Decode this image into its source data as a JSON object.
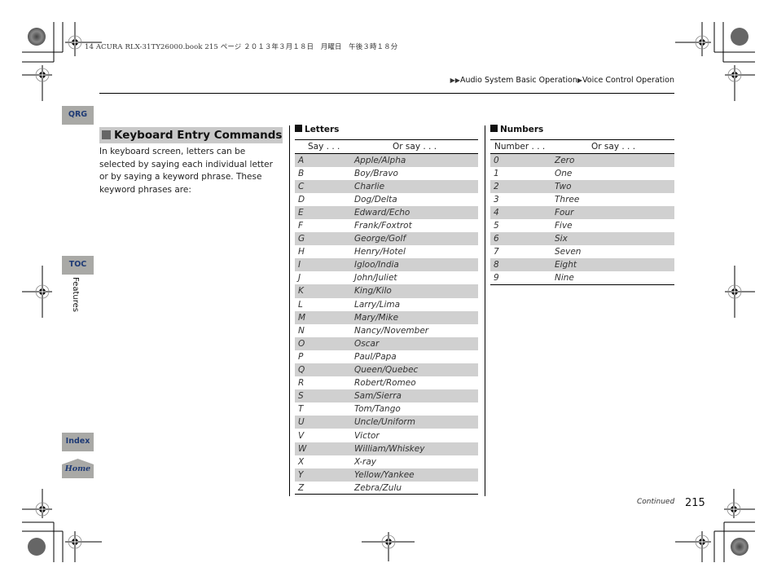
{
  "print_header": "14 ACURA RLX-31TY26000.book  215 ページ  ２０１３年３月１８日　月曜日　午後３時１８分",
  "breadcrumb": {
    "prefix": "▶▶",
    "items": [
      "Audio System Basic Operation",
      "Voice Control Operation"
    ],
    "separator": "▶"
  },
  "side_nav": {
    "qrg": "QRG",
    "toc": "TOC",
    "section_label": "Features",
    "index": "Index",
    "home": "Home"
  },
  "section": {
    "title": "Keyboard Entry Commands",
    "body": "In keyboard screen, letters can be selected by saying each individual letter or by saying a keyword phrase. These keyword phrases are:"
  },
  "letters_table": {
    "title": "Letters",
    "col1": "Say . . .",
    "col2": "Or say . . .",
    "rows": [
      [
        "A",
        "Apple/Alpha"
      ],
      [
        "B",
        "Boy/Bravo"
      ],
      [
        "C",
        "Charlie"
      ],
      [
        "D",
        "Dog/Delta"
      ],
      [
        "E",
        "Edward/Echo"
      ],
      [
        "F",
        "Frank/Foxtrot"
      ],
      [
        "G",
        "George/Golf"
      ],
      [
        "H",
        "Henry/Hotel"
      ],
      [
        "I",
        "Igloo/India"
      ],
      [
        "J",
        "John/Juliet"
      ],
      [
        "K",
        "King/Kilo"
      ],
      [
        "L",
        "Larry/Lima"
      ],
      [
        "M",
        "Mary/Mike"
      ],
      [
        "N",
        "Nancy/November"
      ],
      [
        "O",
        "Oscar"
      ],
      [
        "P",
        "Paul/Papa"
      ],
      [
        "Q",
        "Queen/Quebec"
      ],
      [
        "R",
        "Robert/Romeo"
      ],
      [
        "S",
        "Sam/Sierra"
      ],
      [
        "T",
        "Tom/Tango"
      ],
      [
        "U",
        "Uncle/Uniform"
      ],
      [
        "V",
        "Victor"
      ],
      [
        "W",
        "William/Whiskey"
      ],
      [
        "X",
        "X-ray"
      ],
      [
        "Y",
        "Yellow/Yankee"
      ],
      [
        "Z",
        "Zebra/Zulu"
      ]
    ]
  },
  "numbers_table": {
    "title": "Numbers",
    "col1": "Number . . .",
    "col2": "Or say . . .",
    "rows": [
      [
        "0",
        "Zero"
      ],
      [
        "1",
        "One"
      ],
      [
        "2",
        "Two"
      ],
      [
        "3",
        "Three"
      ],
      [
        "4",
        "Four"
      ],
      [
        "5",
        "Five"
      ],
      [
        "6",
        "Six"
      ],
      [
        "7",
        "Seven"
      ],
      [
        "8",
        "Eight"
      ],
      [
        "9",
        "Nine"
      ]
    ]
  },
  "footer": {
    "continued": "Continued",
    "page_number": "215"
  },
  "colors": {
    "nav_button_bg": "#a9a9a6",
    "nav_button_text": "#1e3a75",
    "row_shade": "#d0d0d0",
    "title_bar": "#c9c9c9"
  }
}
